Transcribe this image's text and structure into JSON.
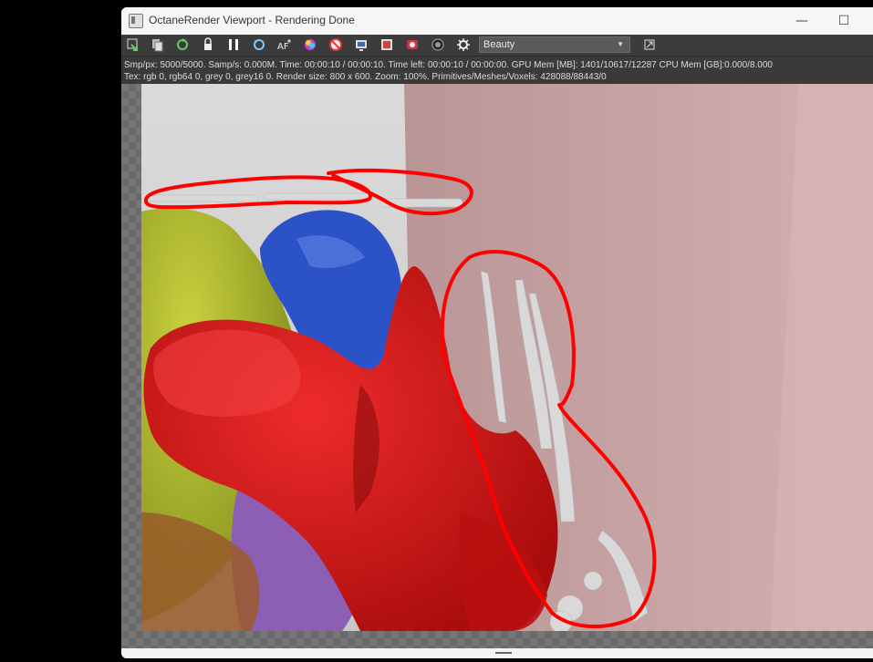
{
  "window": {
    "title": "OctaneRender Viewport - Rendering Done",
    "minimize_glyph": "—",
    "maximize_glyph": "☐"
  },
  "toolbar": {
    "icons": [
      "send-to-viewport-icon",
      "copy-icon",
      "restart-render-icon",
      "lock-icon",
      "pause-icon",
      "reset-icon",
      "af-icon",
      "color-picker-icon",
      "clay-mode-icon",
      "region-render-icon",
      "film-region-icon",
      "settings-icon",
      "camera-icon",
      "gear-icon"
    ],
    "render_pass": "Beauty"
  },
  "stats": {
    "line1": "Smp/px: 5000/5000.   Samp/s: 0.000M.   Time: 00:00:10 / 00:00:10.   Time left: 00:00:10 / 00:00:00.   GPU Mem [MB]: 1401/10617/12287   CPU Mem [GB]:0.000/8.000",
    "line2": "Tex: rgb 0, rgb64 0, grey 0, grey16 0.   Render size: 800 x 600.   Zoom: 100%.   Primitives/Meshes/Voxels: 428088/88443/0"
  },
  "colors": {
    "annotation": "#ff0000",
    "wall_back": "#cfcfcf",
    "wall_right": "#c9a4a6",
    "fluid_red": "#d81818",
    "fluid_blue": "#2b52c6",
    "fluid_yellow": "#b8c233",
    "fluid_purple": "#8c5fb4"
  }
}
